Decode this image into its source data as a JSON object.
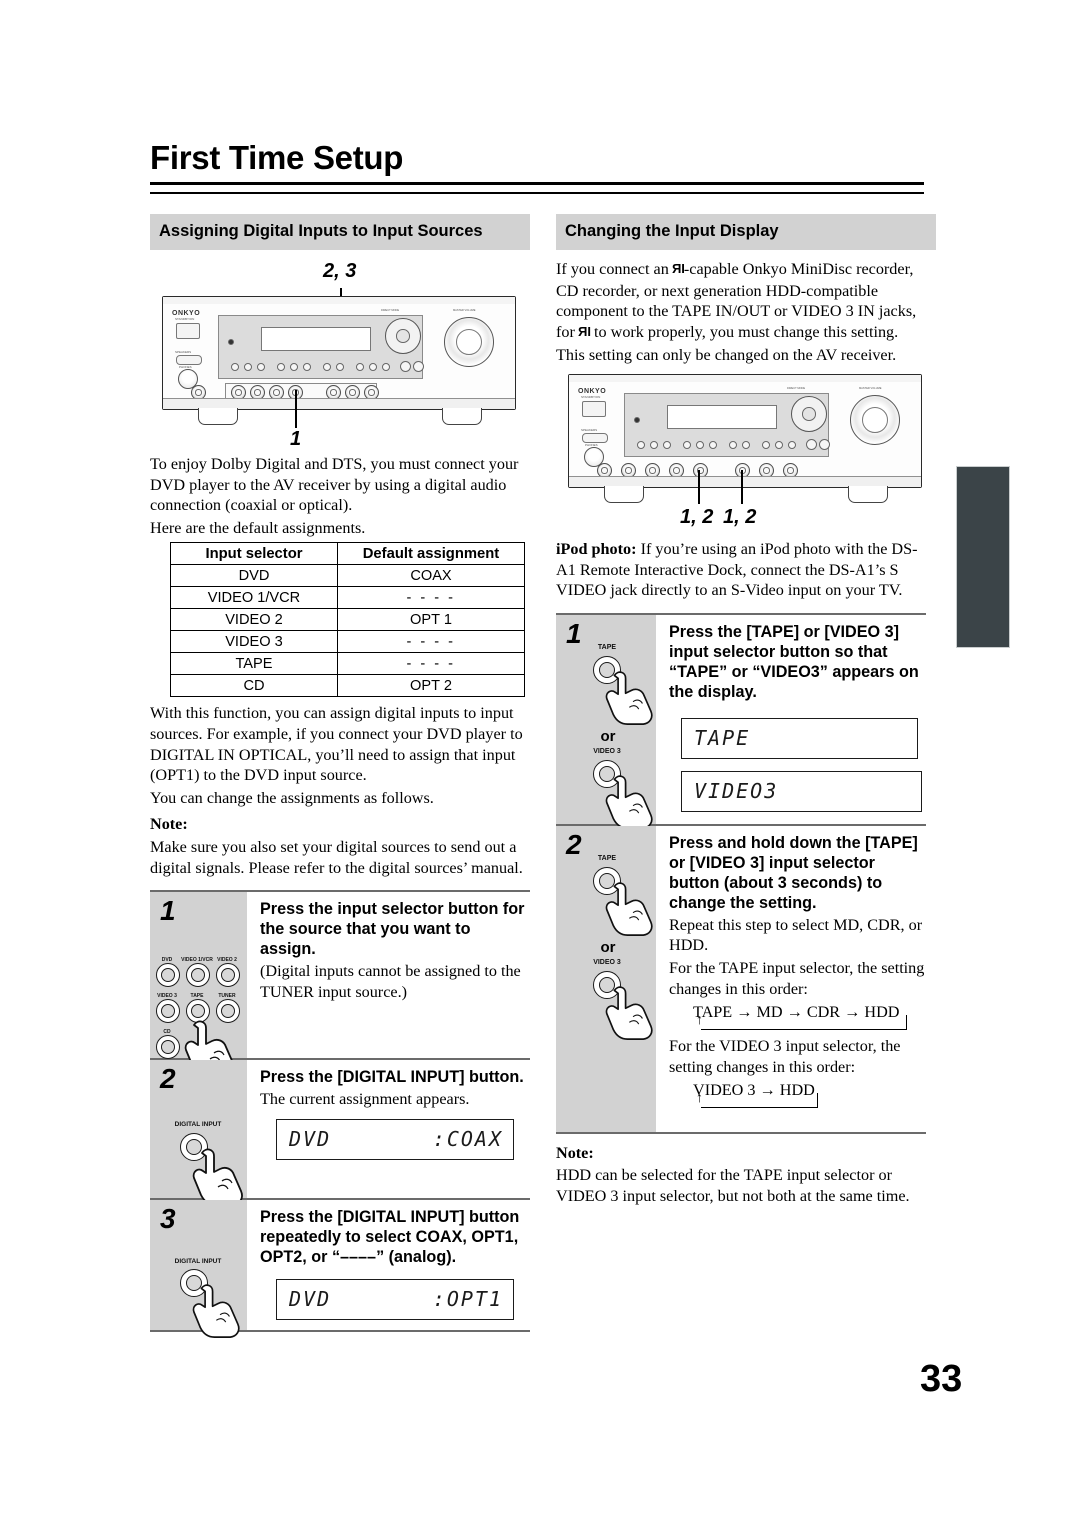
{
  "page": {
    "title": "First Time Setup",
    "number": "33"
  },
  "left": {
    "section_title": "Assigning Digital Inputs to Input Sources",
    "callout_top": "2, 3",
    "callout_bottom": "1",
    "intro_p1": "To enjoy Dolby Digital and DTS, you must connect your DVD player to the AV receiver by using a digital audio connection (coaxial or optical).",
    "intro_p2": "Here are the default assignments.",
    "table": {
      "headers": [
        "Input selector",
        "Default assignment"
      ],
      "rows": [
        [
          "DVD",
          "COAX"
        ],
        [
          "VIDEO 1/VCR",
          "- - - -"
        ],
        [
          "VIDEO 2",
          "OPT 1"
        ],
        [
          "VIDEO 3",
          "- - - -"
        ],
        [
          "TAPE",
          "- - - -"
        ],
        [
          "CD",
          "OPT 2"
        ]
      ]
    },
    "after_table_p1": "With this function, you can assign digital inputs to input sources. For example, if you connect your DVD player to DIGITAL IN OPTICAL, you’ll need to assign that input (OPT1) to the DVD input source.",
    "after_table_p2": "You can change the assignments as follows.",
    "note_label": "Note:",
    "note_body": "Make sure you also set your digital sources to send out a digital signals. Please refer to the digital sources’ manual.",
    "steps": [
      {
        "num": "1",
        "title": "Press the input selector button for the source that you want to assign.",
        "sub": "(Digital inputs cannot be assigned to the TUNER input source.)",
        "button_labels": [
          "DVD",
          "VIDEO 1/VCR",
          "VIDEO 2",
          "VIDEO 3",
          "TAPE",
          "TUNER",
          "CD"
        ]
      },
      {
        "num": "2",
        "title": "Press the [DIGITAL INPUT] button.",
        "sub": "The current assignment appears.",
        "button_label": "DIGITAL INPUT",
        "display_left": "DVD",
        "display_right": ":COAX"
      },
      {
        "num": "3",
        "title": "Press the [DIGITAL INPUT] button repeatedly to select COAX, OPT1, OPT2, or “––––” (analog).",
        "sub": "",
        "button_label": "DIGITAL INPUT",
        "display_left": "DVD",
        "display_right": ":OPT1"
      }
    ]
  },
  "right": {
    "section_title": "Changing the Input Display",
    "intro_p1_a": "If you connect an ",
    "intro_p1_b": "-capable Onkyo MiniDisc recorder, CD recorder, or next generation HDD-compatible component to the TAPE IN/OUT or VIDEO 3 IN jacks, for ",
    "intro_p1_c": " to work properly, you must change this setting.",
    "intro_p2": "This setting can only be changed on the AV receiver.",
    "callout_a": "1, 2",
    "callout_b": "1, 2",
    "ipod_label": "iPod photo:",
    "ipod_body": " If you’re using an iPod photo with the DS-A1 Remote Interactive Dock, connect the DS-A1’s S VIDEO jack directly to an S-Video input on your TV.",
    "steps": [
      {
        "num": "1",
        "title": "Press the [TAPE] or [VIDEO 3] input selector button so that “TAPE” or “VIDEO3” appears on the display.",
        "button_label_a": "TAPE",
        "or_label": "or",
        "button_label_b": "VIDEO 3",
        "display_a": "TAPE",
        "display_b": "VIDEO3"
      },
      {
        "num": "2",
        "title": "Press and hold down the [TAPE] or [VIDEO 3] input selector button (about 3 seconds) to change the setting.",
        "button_label_a": "TAPE",
        "or_label": "or",
        "button_label_b": "VIDEO 3",
        "sub1": "Repeat this step to select MD, CDR, or HDD.",
        "sub2": "For the TAPE input selector, the setting changes in this order:",
        "flow1": "TAPE → MD → CDR → HDD",
        "sub3": "For the VIDEO 3 input selector, the setting changes in this order:",
        "flow2": "VIDEO 3 → HDD"
      }
    ],
    "note_label": "Note:",
    "note_body": "HDD can be selected for the TAPE input selector or VIDEO 3 input selector, but not both at the same time."
  },
  "receiver": {
    "brand": "ONKYO",
    "labels": {
      "direct_mode": "DIRECT MODE",
      "master_volume": "MASTER VOLUME",
      "phones": "PHONES",
      "standby": "STANDBY/ON"
    }
  },
  "colors": {
    "section_header_bg": "#d2d2d2",
    "step_panel_bg": "#d2d2d2",
    "edge_tab": "#3b4448",
    "rule": "#000000"
  }
}
